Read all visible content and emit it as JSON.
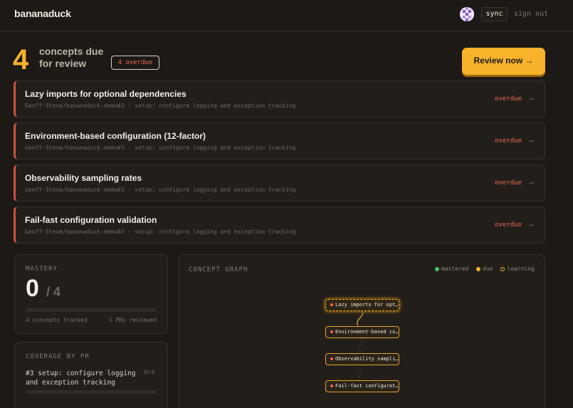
{
  "app": {
    "brand": "bananaduck",
    "sync_label": "sync",
    "signout_label": "sign out"
  },
  "hero": {
    "count": "4",
    "due_line1": "concepts due",
    "due_line2": "for review",
    "overdue_badge": "4 overdue",
    "review_button": "Review now →"
  },
  "concepts": [
    {
      "title": "Lazy imports for optional dependencies",
      "meta": "Geoff-Steve/bananaduck-demo#3 · setup: configure logging and exception tracking",
      "status": "overdue",
      "arrow": "→"
    },
    {
      "title": "Environment-based configuration (12-factor)",
      "meta": "Geoff-Steve/bananaduck-demo#3 · setup: configure logging and exception tracking",
      "status": "overdue",
      "arrow": "→"
    },
    {
      "title": "Observability sampling rates",
      "meta": "Geoff-Steve/bananaduck-demo#3 · setup: configure logging and exception tracking",
      "status": "overdue",
      "arrow": "→"
    },
    {
      "title": "Fail-fast configuration validation",
      "meta": "Geoff-Steve/bananaduck-demo#3 · setup: configure logging and exception tracking",
      "status": "overdue",
      "arrow": "→"
    }
  ],
  "mastery": {
    "label": "MASTERY",
    "value": "0",
    "denominator": "/ 4",
    "progress_fraction": 0,
    "tracked": "4 concepts tracked",
    "reviewed": "1 PRs reviewed"
  },
  "coverage": {
    "label": "COVERAGE BY PR",
    "pr_title": "#3 setup: configure logging and exception tracking",
    "pr_count": "0/4",
    "progress_fraction": 0
  },
  "graph": {
    "label": "CONCEPT GRAPH",
    "legend": [
      {
        "label": "mastered",
        "color": "#4fbf6a",
        "style": "filled"
      },
      {
        "label": "due",
        "color": "#f6b22c",
        "style": "filled"
      },
      {
        "label": "learning",
        "color": "#f6b22c",
        "style": "ring"
      }
    ],
    "nodes": [
      {
        "label": "Lazy imports for opt…",
        "active": true
      },
      {
        "label": "Environment-based co…",
        "active": false
      },
      {
        "label": "Observability sampli…",
        "active": false
      },
      {
        "label": "Fail-fast configurat…",
        "active": false
      }
    ]
  },
  "colors": {
    "accent": "#f6b22c",
    "overdue": "#ef6a4f",
    "background": "#1c1916"
  }
}
